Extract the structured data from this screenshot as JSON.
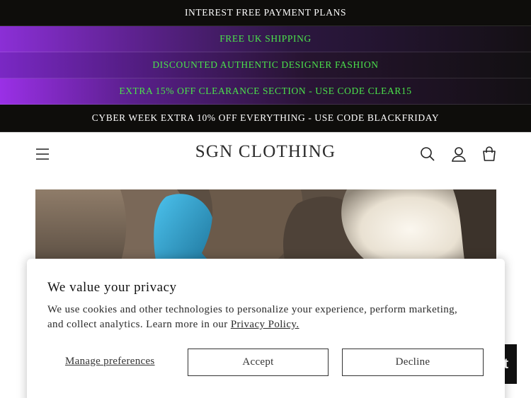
{
  "announcements": [
    "INTEREST FREE PAYMENT PLANS",
    "FREE UK SHIPPING",
    "DISCOUNTED AUTHENTIC DESIGNER FASHION",
    "EXTRA 15% OFF CLEARANCE SECTION - USE CODE CLEAR15",
    "CYBER WEEK EXTRA 10% OFF EVERYTHING - USE CODE BLACKFRIDAY"
  ],
  "header": {
    "brand": "SGN CLOTHING",
    "icons": [
      "menu-icon",
      "search-icon",
      "account-icon",
      "cart-icon"
    ]
  },
  "consent": {
    "title": "We value your privacy",
    "body": "We use cookies and other technologies to personalize your experience, perform marketing, and collect analytics. Learn more in our ",
    "policy_link": "Privacy Policy.",
    "manage_label": "Manage preferences",
    "accept_label": "Accept",
    "decline_label": "Decline"
  },
  "chat": {
    "glyph": "t"
  },
  "colors": {
    "announcement_dark": "#0e0d0b",
    "announcement_purple": "#8b2fd6",
    "promo_text_green": "#4be34b",
    "brand_text": "#2b2b2b"
  }
}
